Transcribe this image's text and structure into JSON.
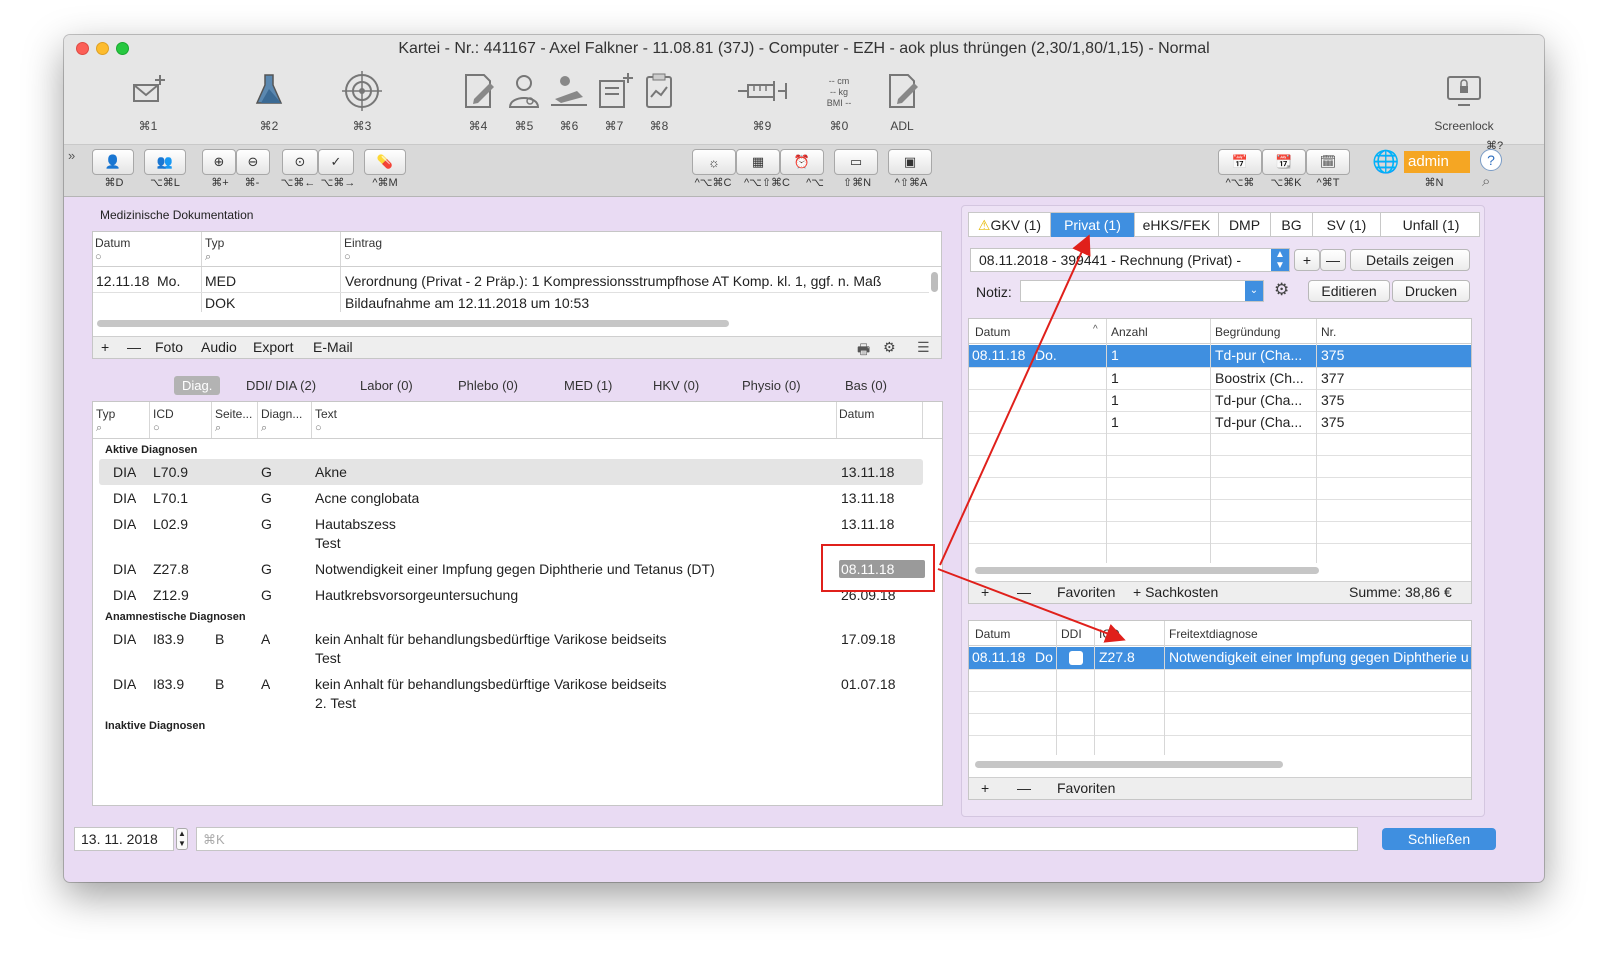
{
  "window": {
    "title": "Kartei - Nr.: 441167 - Axel Falkner - 11.08.81 (37J) - Computer  - EZH - aok plus thrüngen (2,30/1,80/1,15) - Normal"
  },
  "toolbar": {
    "buttons": [
      {
        "icon": "mail-add-icon",
        "label": "⌘1"
      },
      {
        "icon": "flask-icon",
        "label": "⌘2"
      },
      {
        "icon": "target-icon",
        "label": "⌘3"
      },
      {
        "icon": "edit-document-icon",
        "label": "⌘4"
      },
      {
        "icon": "doctor-icon",
        "label": "⌘5"
      },
      {
        "icon": "patient-bed-icon",
        "label": "⌘6"
      },
      {
        "icon": "clipboard-add-icon",
        "label": "⌘7"
      },
      {
        "icon": "clipboard-chart-icon",
        "label": "⌘8"
      },
      {
        "icon": "syringe-icon",
        "label": "⌘9"
      },
      {
        "icon": "bmi-icon",
        "label": "⌘0"
      },
      {
        "icon": "adl-icon",
        "label": "ADL"
      }
    ],
    "bmi_lines": [
      "-- cm",
      "-- kg",
      "BMI --"
    ],
    "screenlock_label": "Screenlock",
    "screenlock_shortcut": "⌘?"
  },
  "secondary_toolbar": {
    "left_labels": [
      "⌘D",
      "⌥⌘L",
      "⌘+",
      "⌘-",
      "⌥⌘←",
      "⌥⌘→",
      "^⌘M"
    ],
    "mid_labels": [
      "^⌥⌘C",
      "^⌥⇧⌘C",
      "^⌥",
      "⇧⌘N",
      "^⇧⌘A"
    ],
    "right_labels": [
      "^⌥⌘",
      "⌥⌘K",
      "^⌘T",
      "⌘N"
    ],
    "user": "admin"
  },
  "med_doc": {
    "title": "Medizinische Dokumentation",
    "headers": [
      "Datum",
      "Typ",
      "Eintrag"
    ],
    "rows": [
      {
        "date": "12.11.18",
        "day": "Mo.",
        "type": "MED",
        "entry": "Verordnung (Privat - 2 Präp.): 1 Kompressionsstrumpfhose AT Komp. kl. 1, ggf. n. Maß"
      },
      {
        "date": "",
        "day": "",
        "type": "DOK",
        "entry": "Bildaufnahme am 12.11.2018 um 10:53"
      }
    ],
    "bar": [
      "+",
      "—",
      "Foto",
      "Audio",
      "Export",
      "E-Mail"
    ]
  },
  "diag_tabs": [
    "Diag.",
    "DDI/ DIA (2)",
    "Labor (0)",
    "Phlebo (0)",
    "MED (1)",
    "HKV (0)",
    "Physio (0)",
    "Bas (0)"
  ],
  "diag": {
    "headers": [
      "Typ",
      "ICD",
      "Seite...",
      "Diagn...",
      "Text",
      "Datum"
    ],
    "section_active": "Aktive Diagnosen",
    "section_anamn": "Anamnestische Diagnosen",
    "section_inactive": "Inaktive Diagnosen",
    "active": [
      {
        "typ": "DIA",
        "icd": "L70.9",
        "seite": "",
        "diagn": "G",
        "text": "Akne",
        "text2": "",
        "date": "13.11.18"
      },
      {
        "typ": "DIA",
        "icd": "L70.1",
        "seite": "",
        "diagn": "G",
        "text": "Acne conglobata",
        "text2": "",
        "date": "13.11.18"
      },
      {
        "typ": "DIA",
        "icd": "L02.9",
        "seite": "",
        "diagn": "G",
        "text": "Hautabszess",
        "text2": "Test",
        "date": "13.11.18"
      },
      {
        "typ": "DIA",
        "icd": "Z27.8",
        "seite": "",
        "diagn": "G",
        "text": "Notwendigkeit einer Impfung gegen Diphtherie und Tetanus (DT)",
        "text2": "",
        "date": "08.11.18"
      },
      {
        "typ": "DIA",
        "icd": "Z12.9",
        "seite": "",
        "diagn": "G",
        "text": "Hautkrebsvorsorgeuntersuchung",
        "text2": "",
        "date": "26.09.18"
      }
    ],
    "anamn": [
      {
        "typ": "DIA",
        "icd": "I83.9",
        "seite": "B",
        "diagn": "A",
        "text": "kein Anhalt für  behandlungsbedürftige Varikose beidseits",
        "text2": "Test",
        "date": "17.09.18"
      },
      {
        "typ": "DIA",
        "icd": "I83.9",
        "seite": "B",
        "diagn": "A",
        "text": "kein Anhalt für  behandlungsbedürftige Varikose beidseits",
        "text2": "2. Test",
        "date": "01.07.18"
      }
    ]
  },
  "right_tabs": [
    "GKV (1)",
    "Privat (1)",
    "eHKS/FEK",
    "DMP",
    "BG",
    "SV (1)",
    "Unfall (1)"
  ],
  "invoice": {
    "select": "08.11.2018 - 399441 - Rechnung (Privat) -",
    "details": "Details zeigen",
    "notiz_label": "Notiz:",
    "edit": "Editieren",
    "print": "Drucken",
    "headers": [
      "Datum",
      "Anzahl",
      "Begründung",
      "Nr."
    ],
    "rows": [
      {
        "date": "08.11.18",
        "day": "Do.",
        "count": "1",
        "reason": "Td-pur (Cha...",
        "nr": "375"
      },
      {
        "date": "",
        "day": "",
        "count": "1",
        "reason": "Boostrix (Ch...",
        "nr": "377"
      },
      {
        "date": "",
        "day": "",
        "count": "1",
        "reason": "Td-pur (Cha...",
        "nr": "375"
      },
      {
        "date": "",
        "day": "",
        "count": "1",
        "reason": "Td-pur (Cha...",
        "nr": "375"
      }
    ],
    "bar": [
      "+",
      "—",
      "Favoriten",
      "+ Sachkosten"
    ],
    "sum": "Summe: 38,86 €"
  },
  "diag_right": {
    "headers": [
      "Datum",
      "DDI",
      "ICD",
      "Freitextdiagnose"
    ],
    "row": {
      "date": "08.11.18",
      "day": "Do",
      "icd": "Z27.8",
      "text": "Notwendigkeit einer Impfung gegen Diphtherie und Tetanus (DT)"
    },
    "bar": [
      "+",
      "—",
      "Favoriten"
    ]
  },
  "footer": {
    "date": "13. 11. 2018",
    "placeholder": "⌘K",
    "close": "Schließen"
  },
  "colors": {
    "accent": "#3f8fe0",
    "annotation": "#e0201b",
    "window_bg": "#e9dbf3"
  }
}
